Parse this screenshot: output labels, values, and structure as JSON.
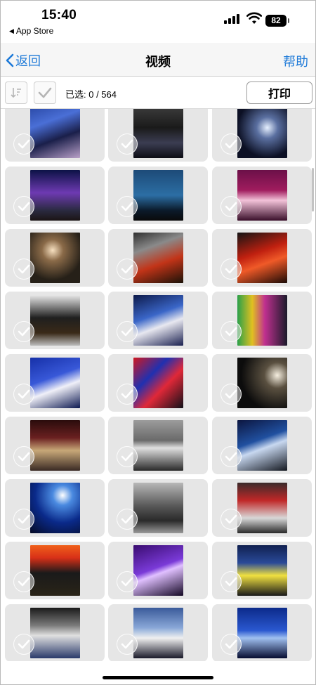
{
  "status_bar": {
    "time": "15:40",
    "back_app_label": "App Store",
    "battery": "82"
  },
  "nav": {
    "back_label": "返回",
    "title": "视频",
    "help_label": "帮助"
  },
  "toolbar": {
    "selected_count": "已选: 0 / 564",
    "print_label": "打印"
  },
  "thumbnails": [
    {
      "bg": "linear-gradient(160deg,#2b4aa8 0%,#4a6fd6 30%,#1a1f4a 60%,#b9a0c8 100%)"
    },
    {
      "bg": "linear-gradient(180deg,#3a3a3a 0%,#1a1a1a 40%,#3b3d52 70%,#0d0d14 100%)"
    },
    {
      "bg": "radial-gradient(circle at 60% 40%,#e6f0ff 0%,#5a6fa0 25%,#0c1024 70%)"
    },
    {
      "bg": "linear-gradient(180deg,#0c1246 0%,#6e3ab2 45%,#2a2a40 80%,#1b1414 100%)"
    },
    {
      "bg": "linear-gradient(180deg,#1d4a78 0%,#2c6ea4 50%,#0b1a2a 80%,#0a0a0a 100%)"
    },
    {
      "bg": "linear-gradient(180deg,#6b1048 0%,#a01c5e 40%,#f2c2d8 60%,#3a0f2a 100%)"
    },
    {
      "bg": "radial-gradient(circle at 45% 35%,#f7e0c0 0%,#8a6a48 25%,#262018 70%)"
    },
    {
      "bg": "linear-gradient(160deg,#303030 0%,#8a8a8a 30%,#c23418 60%,#1a1208 100%)"
    },
    {
      "bg": "linear-gradient(160deg,#141414 0%,#c02010 40%,#f05a28 60%,#1a0a06 100%)"
    },
    {
      "bg": "linear-gradient(180deg,#e8e8e8 0%,#1f1f1f 45%,#3a2a18 75%,#bdbdbd 100%)"
    },
    {
      "bg": "linear-gradient(160deg,#0d1a4a 0%,#3a66c8 40%,#e8e8f0 60%,#1a2050 100%)"
    },
    {
      "bg": "linear-gradient(90deg,#2aa04a 0%,#e0c020 30%,#c03090 55%,#1a1a2a 100%)"
    },
    {
      "bg": "linear-gradient(160deg,#1630a8 0%,#3858d8 40%,#f0f0f8 60%,#0c1850 100%)"
    },
    {
      "bg": "linear-gradient(135deg,#d01820 0%,#2030b0 35%,#e02838 60%,#101018 100%)"
    },
    {
      "bg": "radial-gradient(circle at 80% 35%,#f6efe0 0%,#5a5040 25%,#0c0c0c 70%)"
    },
    {
      "bg": "linear-gradient(180deg,#2a0c0c 0%,#6a2020 35%,#c8a878 60%,#3a2a24 100%)"
    },
    {
      "bg": "linear-gradient(180deg,#9c9c9c 0%,#6a6a6a 40%,#e0e0e0 55%,#2a2a2a 100%)"
    },
    {
      "bg": "linear-gradient(160deg,#0c1640 0%,#2050a0 40%,#c8d8f0 55%,#141820 100%)"
    },
    {
      "bg": "radial-gradient(circle at 65% 25%,#ffffff 0%,#4a8ae0 20%,#0a2a8a 55%,#050a24 100%)"
    },
    {
      "bg": "linear-gradient(180deg,#b8b8b8 0%,#5a5a5a 45%,#2a2a2a 75%,#9a9a9a 100%)"
    },
    {
      "bg": "linear-gradient(180deg,#3a2a2a 0%,#c02828 35%,#d8d8d8 70%,#2a2a2a 100%)"
    },
    {
      "bg": "linear-gradient(180deg,#f0601a 0%,#d83018 25%,#1a1a1a 55%,#2a2418 100%)"
    },
    {
      "bg": "linear-gradient(160deg,#3a0c70 0%,#7a3ad8 45%,#e0c0ff 55%,#140824 100%)"
    },
    {
      "bg": "linear-gradient(180deg,#102050 0%,#2a4a98 35%,#f0e040 60%,#1a1a1a 100%)"
    },
    {
      "bg": "linear-gradient(180deg,#1a1a1a 0%,#7a7a7a 35%,#e0e0e0 55%,#2a3a6a 100%)"
    },
    {
      "bg": "linear-gradient(180deg,#3a5a9a 0%,#8aa8d8 40%,#f0f0f0 60%,#1a1a2a 100%)"
    },
    {
      "bg": "linear-gradient(180deg,#0c2a8a 0%,#2a58d0 45%,#a0c0f0 60%,#060c30 100%)"
    }
  ]
}
